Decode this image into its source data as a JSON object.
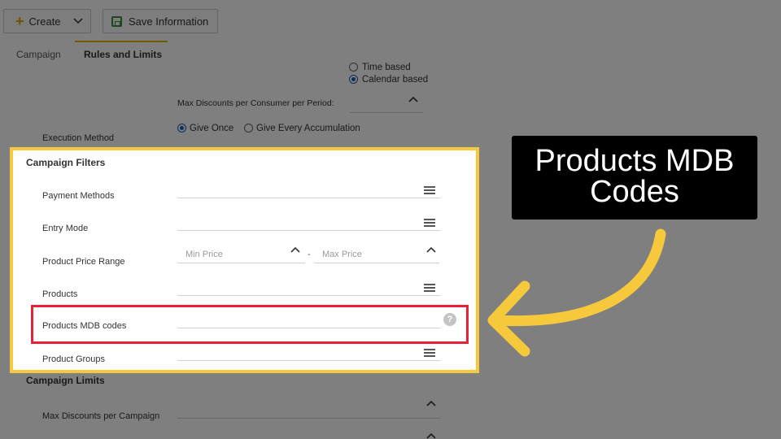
{
  "toolbar": {
    "create_label": "Create",
    "save_label": "Save Information"
  },
  "tabs": [
    {
      "label": "Campaign"
    },
    {
      "label": "Rules and Limits"
    }
  ],
  "period": {
    "option_time": "Time based",
    "option_calendar": "Calendar based",
    "max_discounts_label": "Max Discounts per Consumer per Period:"
  },
  "execution": {
    "label": "Execution Method",
    "option_once": "Give Once",
    "option_every": "Give Every Accumulation"
  },
  "filters": {
    "title": "Campaign Filters",
    "payment_methods": "Payment Methods",
    "entry_mode": "Entry Mode",
    "price_range": "Product Price Range",
    "min_price_placeholder": "Min Price",
    "range_separator": "-",
    "max_price_placeholder": "Max Price",
    "products": "Products",
    "products_mdb_codes": "Products MDB codes",
    "product_groups": "Product Groups"
  },
  "limits": {
    "title": "Campaign Limits",
    "max_discounts_campaign": "Max Discounts per Campaign"
  },
  "callout": {
    "line1": "Products MDB",
    "line2": "Codes"
  },
  "colors": {
    "highlight_panel": "#f6c93c",
    "red_box": "#e8203a",
    "arrow": "#f6c93c",
    "accent": "#e7b500"
  }
}
